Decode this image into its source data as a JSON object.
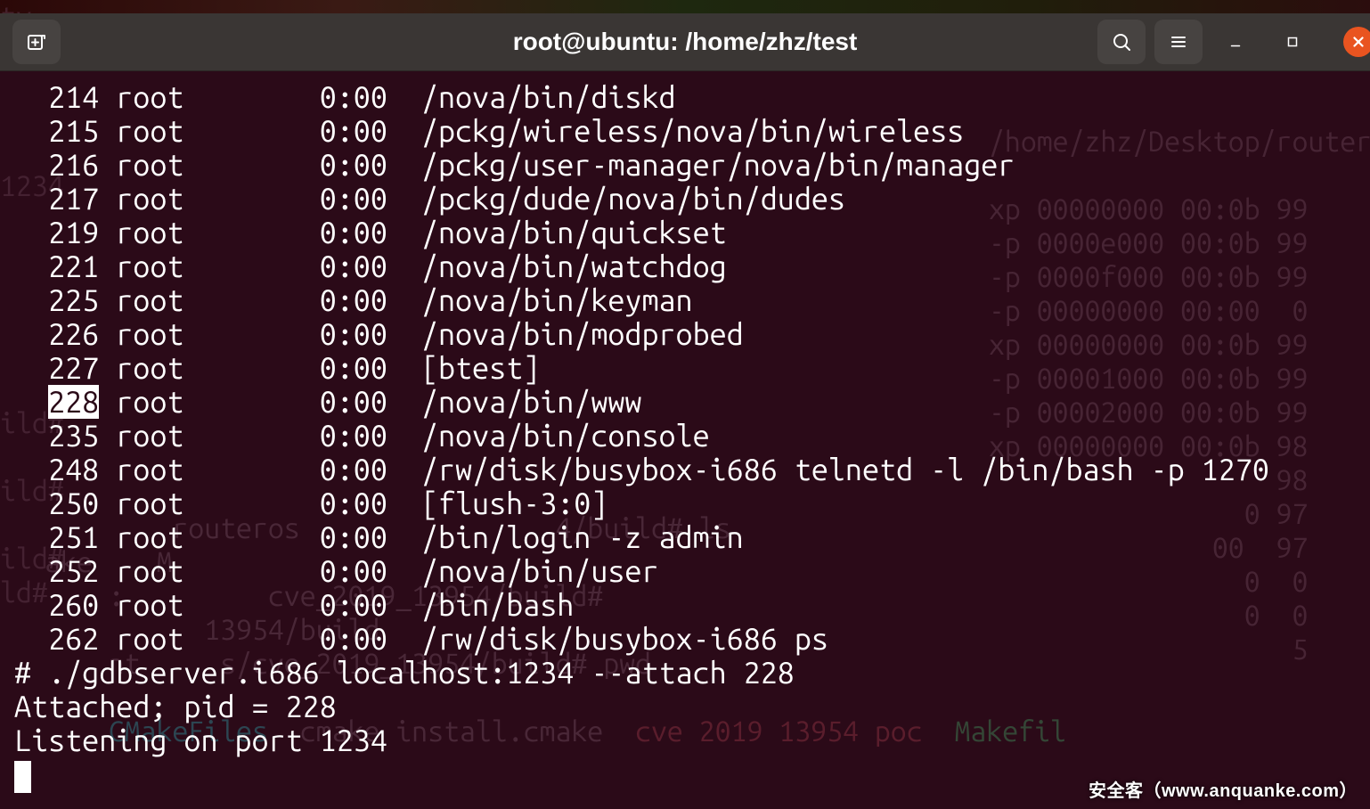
{
  "window": {
    "title": "root@ubuntu: /home/zhz/test"
  },
  "process_list": [
    {
      "pid": "214",
      "user": "root",
      "time": "0:00",
      "cmd": "/nova/bin/diskd",
      "highlight": false
    },
    {
      "pid": "215",
      "user": "root",
      "time": "0:00",
      "cmd": "/pckg/wireless/nova/bin/wireless",
      "highlight": false
    },
    {
      "pid": "216",
      "user": "root",
      "time": "0:00",
      "cmd": "/pckg/user-manager/nova/bin/manager",
      "highlight": false
    },
    {
      "pid": "217",
      "user": "root",
      "time": "0:00",
      "cmd": "/pckg/dude/nova/bin/dudes",
      "highlight": false
    },
    {
      "pid": "219",
      "user": "root",
      "time": "0:00",
      "cmd": "/nova/bin/quickset",
      "highlight": false
    },
    {
      "pid": "221",
      "user": "root",
      "time": "0:00",
      "cmd": "/nova/bin/watchdog",
      "highlight": false
    },
    {
      "pid": "225",
      "user": "root",
      "time": "0:00",
      "cmd": "/nova/bin/keyman",
      "highlight": false
    },
    {
      "pid": "226",
      "user": "root",
      "time": "0:00",
      "cmd": "/nova/bin/modprobed",
      "highlight": false
    },
    {
      "pid": "227",
      "user": "root",
      "time": "0:00",
      "cmd": "[btest]",
      "highlight": false
    },
    {
      "pid": "228",
      "user": "root",
      "time": "0:00",
      "cmd": "/nova/bin/www",
      "highlight": true
    },
    {
      "pid": "235",
      "user": "root",
      "time": "0:00",
      "cmd": "/nova/bin/console",
      "highlight": false
    },
    {
      "pid": "248",
      "user": "root",
      "time": "0:00",
      "cmd": "/rw/disk/busybox-i686 telnetd -l /bin/bash -p 1270",
      "highlight": false
    },
    {
      "pid": "250",
      "user": "root",
      "time": "0:00",
      "cmd": "[flush-3:0]",
      "highlight": false
    },
    {
      "pid": "251",
      "user": "root",
      "time": "0:00",
      "cmd": "/bin/login -z admin",
      "highlight": false
    },
    {
      "pid": "252",
      "user": "root",
      "time": "0:00",
      "cmd": "/nova/bin/user",
      "highlight": false
    },
    {
      "pid": "260",
      "user": "root",
      "time": "0:00",
      "cmd": "/bin/bash",
      "highlight": false
    },
    {
      "pid": "262",
      "user": "root",
      "time": "0:00",
      "cmd": "/rw/disk/busybox-i686 ps",
      "highlight": false
    }
  ],
  "post_lines": [
    "# ./gdbserver.i686 localhost:1234 --attach 228",
    "Attached; pid = 228",
    "Listening on port 1234"
  ],
  "background": {
    "left": "tv\nW\n\n\n\n1234\n\n\n\n\n\n\nild#\n\nild#\n\nild#\nld#",
    "right_prefix": "/home/zhz/Desktop/routere",
    "right_rows": [
      "xp 00000000 00:0b 99",
      "-p 0000e000 00:0b 99",
      "-p 0000f000 00:0b 99",
      "-p 00000000 00:00  0",
      "xp 00000000 00:0b 99",
      "-p 00001000 00:0b 99",
      "-p 00002000 00:0b 99",
      "xp 00000000 00:0b 98",
      "                  98",
      "                0 97",
      "              00  97",
      "                0  0",
      "                0  0",
      "                   5"
    ],
    "mid": "    routeros                4/build# ls\nake    M\n    :         cve_2019_13954/build#\n          13954/build\n    nt     s/cve_2019_13954/build# pwd",
    "bottom_cyan": "CMakeFiles",
    "bottom_plain": "  cmake install.cmake  ",
    "bottom_red": "cve 2019 13954 poc",
    "bottom_grn": "  Makefil"
  },
  "watermark": "安全客（www.anquanke.com）"
}
